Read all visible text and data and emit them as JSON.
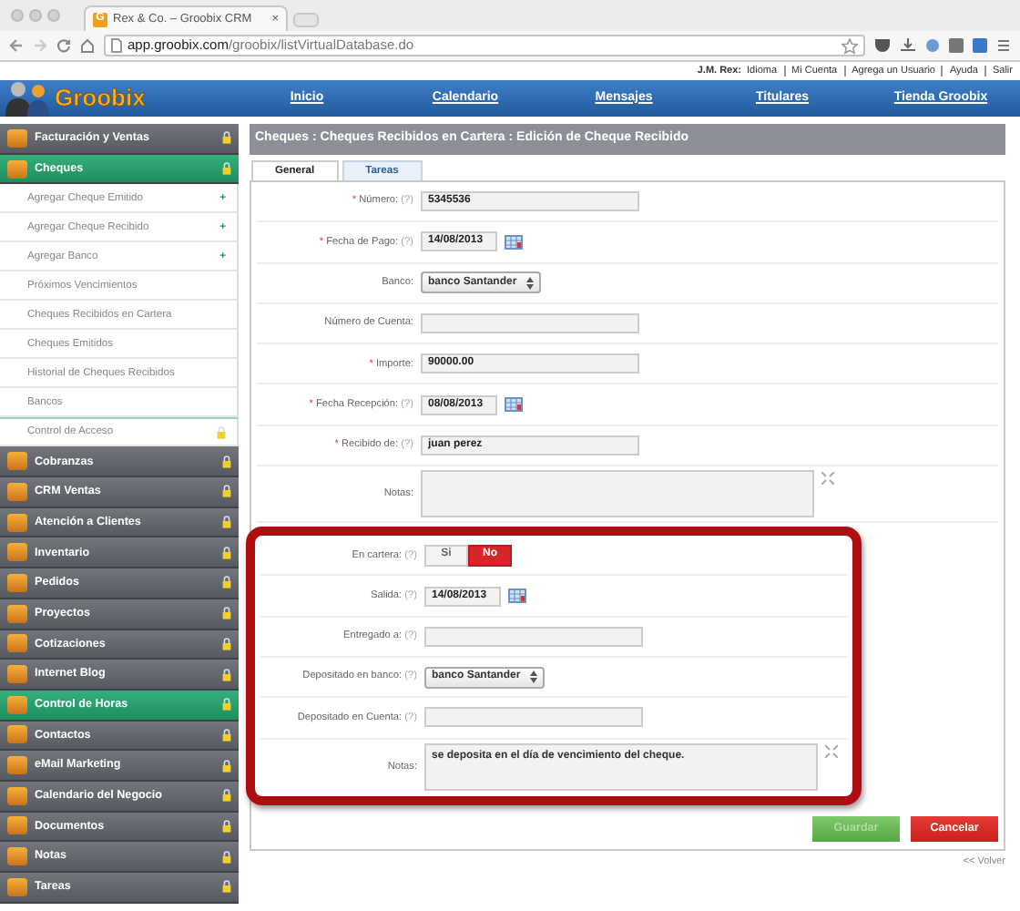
{
  "browser": {
    "tab": {
      "favicon": "G",
      "title": "Rex & Co. – Groobix CRM",
      "close": "×"
    },
    "url_host": "app.groobix.com",
    "url_path": "/groobix/listVirtualDatabase.do"
  },
  "user_bar": {
    "user": "J.M. Rex:",
    "links": [
      "Idioma",
      "Mi Cuenta",
      "Agrega un Usuario",
      "Ayuda",
      "Salir"
    ]
  },
  "logo": "Groobix",
  "nav": [
    "Inicio",
    "Calendario",
    "Mensajes",
    "Titulares",
    "Tienda Groobix"
  ],
  "sidebar": {
    "items": [
      {
        "label": "Facturación y Ventas",
        "selected": false,
        "locked": true
      },
      {
        "label": "Cheques",
        "selected": true,
        "locked": true,
        "children": [
          {
            "label": "Agregar Cheque Emitido",
            "action": "+",
            "locked": false
          },
          {
            "label": "Agregar Cheque Recibido",
            "action": "+",
            "locked": false
          },
          {
            "label": "Agregar Banco",
            "action": "+",
            "locked": false
          },
          {
            "label": "Próximos Vencimientos",
            "locked": false
          },
          {
            "label": "Cheques Recibidos en Cartera",
            "locked": false
          },
          {
            "label": "Cheques Emitidos",
            "locked": false
          },
          {
            "label": "Historial de Cheques Recibidos",
            "locked": false
          },
          {
            "label": "Bancos",
            "locked": false
          },
          {
            "label": "Control de Acceso",
            "locked": true
          }
        ]
      },
      {
        "label": "Cobranzas",
        "selected": false,
        "locked": true
      },
      {
        "label": "CRM Ventas",
        "selected": false,
        "locked": true
      },
      {
        "label": "Atención a Clientes",
        "selected": false,
        "locked": true
      },
      {
        "label": "Inventario",
        "selected": false,
        "locked": true
      },
      {
        "label": "Pedidos",
        "selected": false,
        "locked": true
      },
      {
        "label": "Proyectos",
        "selected": false,
        "locked": true
      },
      {
        "label": "Cotizaciones",
        "selected": false,
        "locked": true
      },
      {
        "label": "Internet Blog",
        "selected": false,
        "locked": true
      },
      {
        "label": "Control de Horas",
        "selected": true,
        "locked": true
      },
      {
        "label": "Contactos",
        "selected": false,
        "locked": true
      },
      {
        "label": "eMail Marketing",
        "selected": false,
        "locked": true
      },
      {
        "label": "Calendario del Negocio",
        "selected": false,
        "locked": true
      },
      {
        "label": "Documentos",
        "selected": false,
        "locked": true
      },
      {
        "label": "Notas",
        "selected": false,
        "locked": true
      },
      {
        "label": "Tareas",
        "selected": false,
        "locked": true
      }
    ]
  },
  "page_title": "Cheques : Cheques Recibidos en Cartera : Edición de Cheque Recibido",
  "tabs": [
    {
      "label": "General",
      "selected": true
    },
    {
      "label": "Tareas",
      "selected": false
    }
  ],
  "form": {
    "sections": [
      {
        "highlighted": false,
        "rows": [
          {
            "kind": "text",
            "label": "Número:",
            "required_mark": "*",
            "help": "(?)",
            "value": "5345536"
          },
          {
            "kind": "date",
            "label": "Fecha de Pago:",
            "required_mark": "*",
            "help": "(?)",
            "value": "14/08/2013"
          },
          {
            "kind": "select",
            "label": "Banco:",
            "value": "banco Santander"
          },
          {
            "kind": "text",
            "label": "Número de Cuenta:",
            "value": ""
          },
          {
            "kind": "text",
            "label": "Importe:",
            "required_mark": "*",
            "value": "90000.00"
          },
          {
            "kind": "date",
            "label": "Fecha Recepción:",
            "required_mark": "*",
            "help": "(?)",
            "value": "08/08/2013"
          },
          {
            "kind": "text",
            "label": "Recibido de:",
            "required_mark": "*",
            "help": "(?)",
            "value": "juan perez"
          },
          {
            "kind": "textarea",
            "label": "Notas:",
            "value": ""
          }
        ]
      },
      {
        "highlighted": true,
        "rows": [
          {
            "kind": "toggle",
            "label": "En cartera:",
            "help": "(?)",
            "options": [
              {
                "label": "Si",
                "selected": false
              },
              {
                "label": "No",
                "selected": true
              }
            ]
          },
          {
            "kind": "date",
            "label": "Salida:",
            "help": "(?)",
            "value": "14/08/2013"
          },
          {
            "kind": "text",
            "label": "Entregado a:",
            "help": "(?)",
            "value": ""
          },
          {
            "kind": "select",
            "label": "Depositado en banco:",
            "help": "(?)",
            "value": "banco Santander"
          },
          {
            "kind": "text",
            "label": "Depositado en Cuenta:",
            "help": "(?)",
            "value": ""
          },
          {
            "kind": "textarea",
            "label": "Notas:",
            "value": "se deposita en el día de vencimiento del cheque."
          }
        ]
      }
    ]
  },
  "buttons": [
    {
      "kind": "save",
      "label": "Guardar",
      "disabled": true
    },
    {
      "kind": "cancel",
      "label": "Cancelar",
      "disabled": false
    }
  ],
  "back_link": "<< Volver"
}
